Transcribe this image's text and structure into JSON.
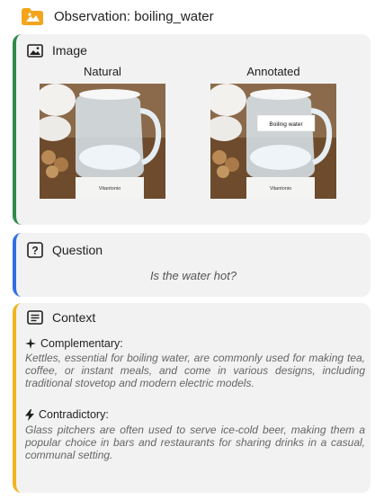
{
  "header": {
    "title": "Observation: boiling_water",
    "icon": "folder-image-icon"
  },
  "image_card": {
    "title": "Image",
    "natural_label": "Natural",
    "annotated_label": "Annotated",
    "annotation_text": "Boiling water",
    "brand_text": "Vitantonio",
    "accent": "#2e8b4a"
  },
  "question_card": {
    "title": "Question",
    "text": "Is the water hot?",
    "accent": "#2f6fe4"
  },
  "context_card": {
    "title": "Context",
    "accent": "#f1b51c",
    "complementary": {
      "label": "Complementary:",
      "text": "Kettles, essential for boiling water, are commonly used for making tea, coffee, or instant meals, and come in various designs, including traditional stovetop and modern electric models."
    },
    "contradictory": {
      "label": "Contradictory:",
      "text": "Glass pitchers are often used to serve ice-cold beer, making them a popular choice in bars and restaurants for sharing drinks in a casual, communal setting."
    }
  }
}
